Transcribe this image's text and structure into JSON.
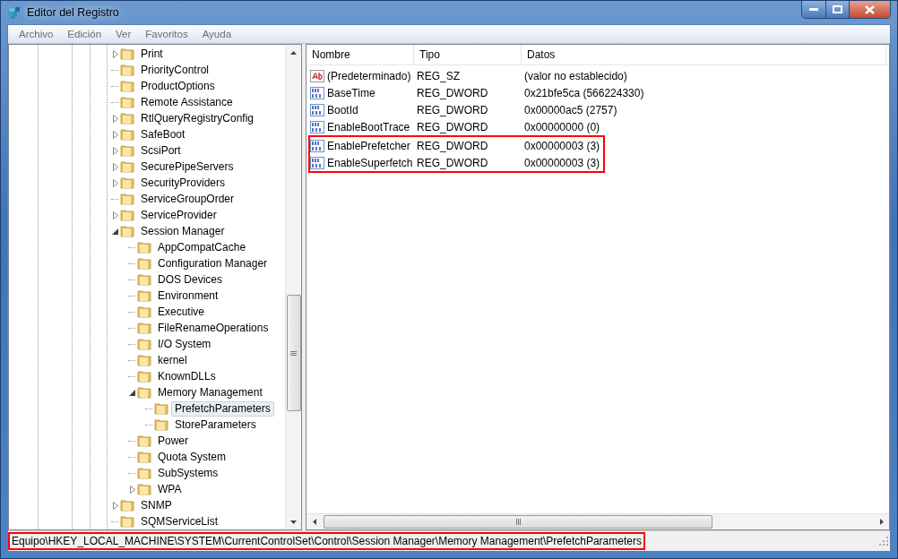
{
  "window": {
    "title": "Editor del Registro"
  },
  "menu": [
    "Archivo",
    "Edición",
    "Ver",
    "Favoritos",
    "Ayuda"
  ],
  "tree": [
    {
      "label": "Print",
      "has_children": true,
      "expanded": false,
      "selected": false
    },
    {
      "label": "PriorityControl",
      "has_children": false,
      "expanded": false,
      "selected": false
    },
    {
      "label": "ProductOptions",
      "has_children": false,
      "expanded": false,
      "selected": false
    },
    {
      "label": "Remote Assistance",
      "has_children": false,
      "expanded": false,
      "selected": false
    },
    {
      "label": "RtlQueryRegistryConfig",
      "has_children": true,
      "expanded": false,
      "selected": false
    },
    {
      "label": "SafeBoot",
      "has_children": true,
      "expanded": false,
      "selected": false
    },
    {
      "label": "ScsiPort",
      "has_children": true,
      "expanded": false,
      "selected": false
    },
    {
      "label": "SecurePipeServers",
      "has_children": true,
      "expanded": false,
      "selected": false
    },
    {
      "label": "SecurityProviders",
      "has_children": true,
      "expanded": false,
      "selected": false
    },
    {
      "label": "ServiceGroupOrder",
      "has_children": false,
      "expanded": false,
      "selected": false
    },
    {
      "label": "ServiceProvider",
      "has_children": true,
      "expanded": false,
      "selected": false
    },
    {
      "label": "Session Manager",
      "has_children": true,
      "expanded": true,
      "selected": false,
      "children": [
        {
          "label": "AppCompatCache",
          "has_children": false,
          "expanded": false,
          "selected": false
        },
        {
          "label": "Configuration Manager",
          "has_children": false,
          "expanded": false,
          "selected": false
        },
        {
          "label": "DOS Devices",
          "has_children": false,
          "expanded": false,
          "selected": false
        },
        {
          "label": "Environment",
          "has_children": false,
          "expanded": false,
          "selected": false
        },
        {
          "label": "Executive",
          "has_children": false,
          "expanded": false,
          "selected": false
        },
        {
          "label": "FileRenameOperations",
          "has_children": false,
          "expanded": false,
          "selected": false
        },
        {
          "label": "I/O System",
          "has_children": false,
          "expanded": false,
          "selected": false
        },
        {
          "label": "kernel",
          "has_children": false,
          "expanded": false,
          "selected": false
        },
        {
          "label": "KnownDLLs",
          "has_children": false,
          "expanded": false,
          "selected": false
        },
        {
          "label": "Memory Management",
          "has_children": true,
          "expanded": true,
          "selected": false,
          "children": [
            {
              "label": "PrefetchParameters",
              "has_children": false,
              "expanded": false,
              "selected": true
            },
            {
              "label": "StoreParameters",
              "has_children": false,
              "expanded": false,
              "selected": false
            }
          ]
        },
        {
          "label": "Power",
          "has_children": false,
          "expanded": false,
          "selected": false
        },
        {
          "label": "Quota System",
          "has_children": false,
          "expanded": false,
          "selected": false
        },
        {
          "label": "SubSystems",
          "has_children": false,
          "expanded": false,
          "selected": false
        },
        {
          "label": "WPA",
          "has_children": true,
          "expanded": false,
          "selected": false
        }
      ]
    },
    {
      "label": "SNMP",
      "has_children": true,
      "expanded": false,
      "selected": false
    },
    {
      "label": "SQMServiceList",
      "has_children": false,
      "expanded": false,
      "selected": false
    }
  ],
  "table": {
    "columns": [
      "Nombre",
      "Tipo",
      "Datos"
    ],
    "rows": [
      {
        "kind": "string",
        "name": "(Predeterminado)",
        "type": "REG_SZ",
        "data": "(valor no establecido)",
        "highlighted": false
      },
      {
        "kind": "binary",
        "name": "BaseTime",
        "type": "REG_DWORD",
        "data": "0x21bfe5ca (566224330)",
        "highlighted": false
      },
      {
        "kind": "binary",
        "name": "BootId",
        "type": "REG_DWORD",
        "data": "0x00000ac5 (2757)",
        "highlighted": false
      },
      {
        "kind": "binary",
        "name": "EnableBootTrace",
        "type": "REG_DWORD",
        "data": "0x00000000 (0)",
        "highlighted": false
      },
      {
        "kind": "binary",
        "name": "EnablePrefetcher",
        "type": "REG_DWORD",
        "data": "0x00000003 (3)",
        "highlighted": true
      },
      {
        "kind": "binary",
        "name": "EnableSuperfetch",
        "type": "REG_DWORD",
        "data": "0x00000003 (3)",
        "highlighted": true
      }
    ]
  },
  "status_bar": {
    "path": "Equipo\\HKEY_LOCAL_MACHINE\\SYSTEM\\CurrentControlSet\\Control\\Session Manager\\Memory Management\\PrefetchParameters",
    "highlighted": true
  }
}
